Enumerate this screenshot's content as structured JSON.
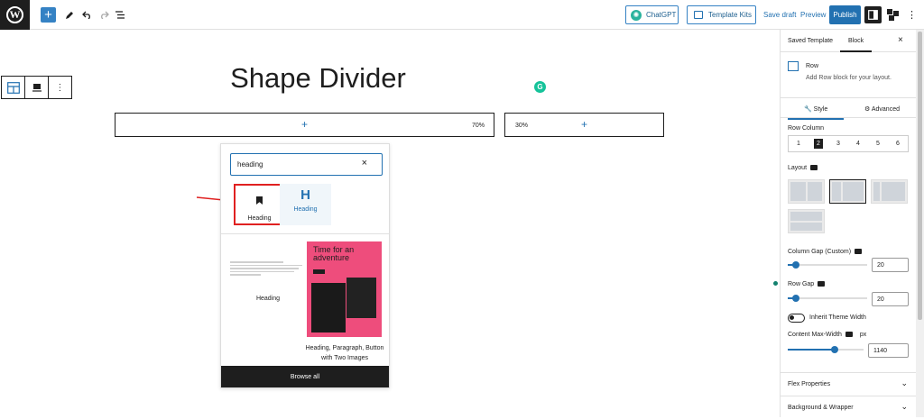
{
  "topbar": {
    "wp_logo": "W",
    "add_label": "+",
    "chatgpt_label": "ChatGPT",
    "template_kits_label": "Template Kits",
    "save_draft": "Save draft",
    "preview": "Preview",
    "publish": "Publish"
  },
  "canvas": {
    "title": "Shape Divider",
    "grammarly_badge": "G",
    "column_left_pct": "70%",
    "column_right_pct": "30%",
    "add_symbol": "+"
  },
  "inserter": {
    "search_value": "heading",
    "clear_symbol": "×",
    "blocks": [
      {
        "label": "Heading",
        "icon": "bookmark-icon"
      },
      {
        "label": "Heading",
        "icon": "H"
      }
    ],
    "pattern_left_label": "Heading",
    "pattern_card_title": "Time for an adventure",
    "pattern_caption": "Heading, Paragraph, Button with Two Images",
    "browse_all": "Browse all"
  },
  "sidebar": {
    "tab_saved_template": "Saved Template",
    "tab_block": "Block",
    "close_symbol": "×",
    "block_name": "Row",
    "block_description": "Add Row block for your layout.",
    "tab_style": "Style",
    "tab_advanced": "Advanced",
    "row_column_label": "Row Column",
    "row_column_options": [
      "1",
      "2",
      "3",
      "4",
      "5",
      "6"
    ],
    "row_column_selected": "2",
    "layout_label": "Layout",
    "column_gap_label": "Column Gap (Custom)",
    "column_gap_value": "20",
    "column_gap_fraction": 0.1,
    "row_gap_label": "Row Gap",
    "row_gap_value": "20",
    "row_gap_fraction": 0.1,
    "inherit_theme_width_label": "Inherit Theme Width",
    "content_max_width_label": "Content Max-Width",
    "content_max_width_unit": "px",
    "content_max_width_value": "1140",
    "content_max_width_fraction": 0.62,
    "flex_properties_label": "Flex Properties",
    "background_wrapper_label": "Background & Wrapper"
  },
  "colors": {
    "accent": "#2271b1",
    "dark": "#1e1e1e",
    "pattern_pink": "#ee4d7c",
    "highlight_red": "#e02020"
  }
}
